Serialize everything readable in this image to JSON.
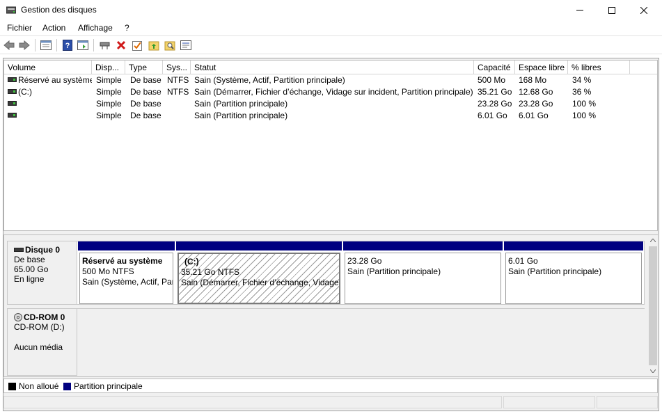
{
  "window": {
    "title": "Gestion des disques"
  },
  "menu": [
    "Fichier",
    "Action",
    "Affichage",
    "?"
  ],
  "toolbar": {
    "icons": [
      "back-arrow-icon",
      "forward-arrow-icon",
      "properties-view-icon",
      "help-icon",
      "action-pane-icon",
      "connect-disk-icon",
      "delete-icon",
      "check-icon",
      "up-folder-icon",
      "search-folder-icon",
      "properties-icon"
    ]
  },
  "volume_table": {
    "columns": [
      "Volume",
      "Disp...",
      "Type",
      "Sys...",
      "Statut",
      "Capacité",
      "Espace libre",
      "% libres"
    ],
    "rows": [
      {
        "volume": "Réservé au système",
        "layout": "Simple",
        "type": "De base",
        "fs": "NTFS",
        "status": "Sain (Système, Actif, Partition principale)",
        "capacity": "500 Mo",
        "free": "168 Mo",
        "pct": "34 %"
      },
      {
        "volume": "(C:)",
        "layout": "Simple",
        "type": "De base",
        "fs": "NTFS",
        "status": "Sain (Démarrer, Fichier d’échange, Vidage sur incident, Partition principale)",
        "capacity": "35.21 Go",
        "free": "12.68 Go",
        "pct": "36 %"
      },
      {
        "volume": "",
        "layout": "Simple",
        "type": "De base",
        "fs": "",
        "status": "Sain (Partition principale)",
        "capacity": "23.28 Go",
        "free": "23.28 Go",
        "pct": "100 %"
      },
      {
        "volume": "",
        "layout": "Simple",
        "type": "De base",
        "fs": "",
        "status": "Sain (Partition principale)",
        "capacity": "6.01 Go",
        "free": "6.01 Go",
        "pct": "100 %"
      }
    ]
  },
  "disks": [
    {
      "name": "Disque 0",
      "kind": "De base",
      "size": "65.00 Go",
      "state": "En ligne",
      "partitions": [
        {
          "name": "Réservé au système",
          "line1": "500 Mo NTFS",
          "line2": "Sain (Système, Actif, Par"
        },
        {
          "name": "(C:)",
          "line1": "35.21 Go NTFS",
          "line2": "Sain (Démarrer, Fichier d’échange, Vidage s"
        },
        {
          "name": "",
          "line1": "23.28 Go",
          "line2": "Sain (Partition principale)"
        },
        {
          "name": "",
          "line1": "6.01 Go",
          "line2": "Sain (Partition principale)"
        }
      ]
    },
    {
      "name": "CD-ROM 0",
      "kind": "CD-ROM (D:)",
      "state": "Aucun média"
    }
  ],
  "legend": [
    {
      "label": "Non alloué",
      "color": "#000000"
    },
    {
      "label": "Partition principale",
      "color": "#000080"
    }
  ]
}
